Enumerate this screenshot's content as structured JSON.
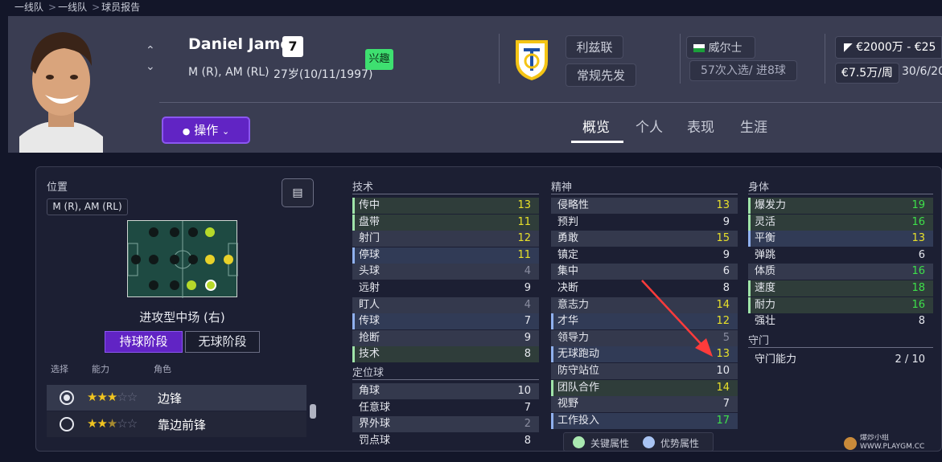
{
  "breadcrumb": [
    "一线队",
    "一线队",
    "球员报告"
  ],
  "player": {
    "name": "Daniel James",
    "number": "7",
    "positions": "M (R), AM (RL)",
    "age_dob": "27岁(10/11/1997)",
    "interest_badge": "兴趣"
  },
  "club": {
    "name": "利兹联",
    "status": "常规先发"
  },
  "nation": {
    "name": "威尔士",
    "caps": "57次入选/ 进8球"
  },
  "contract": {
    "value": "€2000万 - €25",
    "wage": "€7.5万/周",
    "expiry": "30/6/20"
  },
  "actions_label": "操作",
  "tabs": [
    "概览",
    "个人",
    "表现",
    "生涯"
  ],
  "left": {
    "position_label": "位置",
    "position_value": "M (R), AM (RL)",
    "role_name": "进攻型中场 (右)",
    "phase_tabs": [
      "持球阶段",
      "无球阶段"
    ],
    "col_headers": [
      "选择",
      "能力",
      "角色"
    ],
    "roles": [
      {
        "name": "边锋",
        "stars": 3.0
      },
      {
        "name": "靠边前锋",
        "stars": 2.5
      }
    ]
  },
  "technical": {
    "title": "技术",
    "attrs": [
      {
        "name": "传中",
        "value": "13",
        "style": "key",
        "color": "#e8e02a"
      },
      {
        "name": "盘带",
        "value": "11",
        "style": "key",
        "color": "#e8e02a"
      },
      {
        "name": "射门",
        "value": "12",
        "style": "",
        "color": "#e8e02a"
      },
      {
        "name": "停球",
        "value": "11",
        "style": "pref",
        "color": "#e8e02a"
      },
      {
        "name": "头球",
        "value": "4",
        "style": "",
        "color": "#8a8da0"
      },
      {
        "name": "远射",
        "value": "9",
        "style": "",
        "color": "#e6e8ef"
      },
      {
        "name": "盯人",
        "value": "4",
        "style": "",
        "color": "#8a8da0"
      },
      {
        "name": "传球",
        "value": "7",
        "style": "pref",
        "color": "#e6e8ef"
      },
      {
        "name": "抢断",
        "value": "9",
        "style": "",
        "color": "#e6e8ef"
      },
      {
        "name": "技术",
        "value": "8",
        "style": "key",
        "color": "#e6e8ef"
      }
    ]
  },
  "setpieces": {
    "title": "定位球",
    "attrs": [
      {
        "name": "角球",
        "value": "10",
        "style": "",
        "color": "#e6e8ef"
      },
      {
        "name": "任意球",
        "value": "7",
        "style": "",
        "color": "#e6e8ef"
      },
      {
        "name": "界外球",
        "value": "2",
        "style": "",
        "color": "#8a8da0"
      },
      {
        "name": "罚点球",
        "value": "8",
        "style": "",
        "color": "#e6e8ef"
      }
    ]
  },
  "mental": {
    "title": "精神",
    "attrs": [
      {
        "name": "侵略性",
        "value": "13",
        "style": "",
        "color": "#e8e02a"
      },
      {
        "name": "预判",
        "value": "9",
        "style": "",
        "color": "#e6e8ef"
      },
      {
        "name": "勇敢",
        "value": "15",
        "style": "",
        "color": "#e8e02a"
      },
      {
        "name": "镇定",
        "value": "9",
        "style": "",
        "color": "#e6e8ef"
      },
      {
        "name": "集中",
        "value": "6",
        "style": "",
        "color": "#e6e8ef"
      },
      {
        "name": "决断",
        "value": "8",
        "style": "",
        "color": "#e6e8ef"
      },
      {
        "name": "意志力",
        "value": "14",
        "style": "",
        "color": "#e8e02a"
      },
      {
        "name": "才华",
        "value": "12",
        "style": "pref",
        "color": "#e8e02a"
      },
      {
        "name": "领导力",
        "value": "5",
        "style": "",
        "color": "#8a8da0"
      },
      {
        "name": "无球跑动",
        "value": "13",
        "style": "pref",
        "color": "#e8e02a"
      },
      {
        "name": "防守站位",
        "value": "10",
        "style": "",
        "color": "#e6e8ef"
      },
      {
        "name": "团队合作",
        "value": "14",
        "style": "key",
        "color": "#e8e02a"
      },
      {
        "name": "视野",
        "value": "7",
        "style": "",
        "color": "#e6e8ef"
      },
      {
        "name": "工作投入",
        "value": "17",
        "style": "pref",
        "color": "#3ee04a"
      }
    ]
  },
  "physical": {
    "title": "身体",
    "attrs": [
      {
        "name": "爆发力",
        "value": "19",
        "style": "key",
        "color": "#3ee04a"
      },
      {
        "name": "灵活",
        "value": "16",
        "style": "key",
        "color": "#3ee04a"
      },
      {
        "name": "平衡",
        "value": "13",
        "style": "pref",
        "color": "#e8e02a"
      },
      {
        "name": "弹跳",
        "value": "6",
        "style": "",
        "color": "#e6e8ef"
      },
      {
        "name": "体质",
        "value": "16",
        "style": "",
        "color": "#3ee04a"
      },
      {
        "name": "速度",
        "value": "18",
        "style": "key",
        "color": "#3ee04a"
      },
      {
        "name": "耐力",
        "value": "16",
        "style": "key",
        "color": "#3ee04a"
      },
      {
        "name": "强壮",
        "value": "8",
        "style": "",
        "color": "#e6e8ef"
      }
    ]
  },
  "goalkeeping": {
    "title": "守门",
    "attr": "守门能力",
    "value": "2 / 10"
  },
  "legend": {
    "key": "关键属性",
    "pref": "优势属性"
  },
  "watermark": "爆炒小组 WWW.PLAYGM.CC"
}
